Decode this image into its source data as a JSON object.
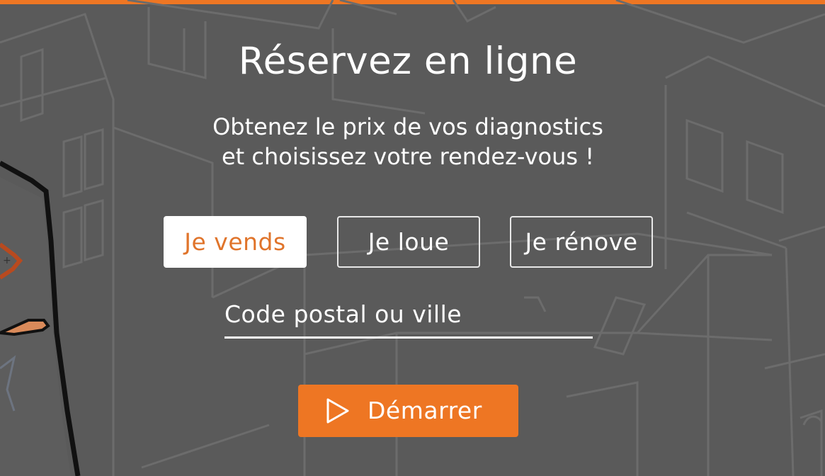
{
  "hero": {
    "title": "Réservez en ligne",
    "subtitle_line1": "Obtenez le prix de vos diagnostics",
    "subtitle_line2": "et choisissez votre rendez-vous !"
  },
  "choices": [
    {
      "label": "Je vends",
      "selected": true
    },
    {
      "label": "Je loue",
      "selected": false
    },
    {
      "label": "Je rénove",
      "selected": false
    }
  ],
  "search": {
    "placeholder": "Code postal ou ville",
    "value": ""
  },
  "start_button": {
    "label": "Démarrer",
    "icon": "play-icon"
  },
  "colors": {
    "accent": "#ee7623",
    "background": "#5a5a5a",
    "selected_text": "#e0742b"
  }
}
